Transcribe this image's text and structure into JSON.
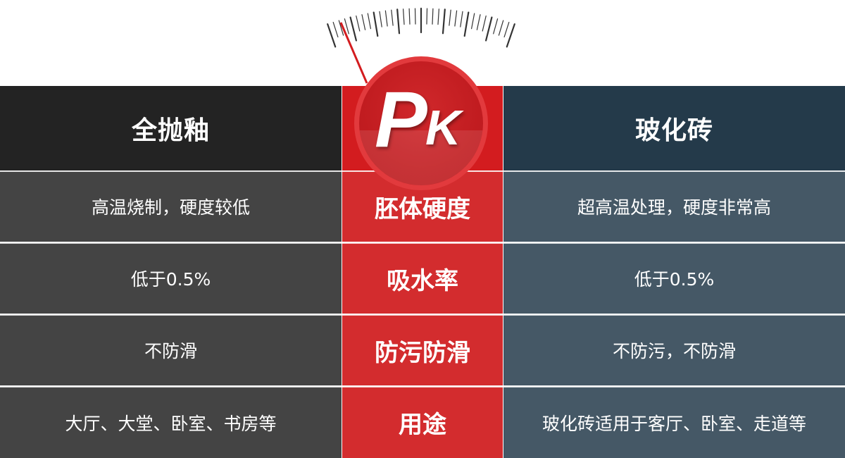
{
  "badge": {
    "p": "P",
    "k": "K"
  },
  "columns": {
    "left": {
      "header": "全抛釉"
    },
    "middle": {
      "header": ""
    },
    "right": {
      "header": "玻化砖"
    }
  },
  "rows": [
    {
      "left": "高温烧制，硬度较低",
      "label": "胚体硬度",
      "right": "超高温处理，硬度非常高"
    },
    {
      "left": "低于0.5%",
      "label": "吸水率",
      "right": "低于0.5%"
    },
    {
      "left": "不防滑",
      "label": "防污防滑",
      "right": "不防污，不防滑"
    },
    {
      "left": "大厅、大堂、卧室、书房等",
      "label": "用途",
      "right": "玻化砖适用于客厅、卧室、走道等"
    }
  ],
  "colors": {
    "left_header": "#232323",
    "left_rows": "#444444",
    "middle": "#d32c2e",
    "right_header": "#243a4a",
    "right_rows": "#455866",
    "needle": "#d31c1f"
  },
  "icons": {
    "gauge": "scale-gauge-icon",
    "needle": "gauge-needle-icon"
  }
}
